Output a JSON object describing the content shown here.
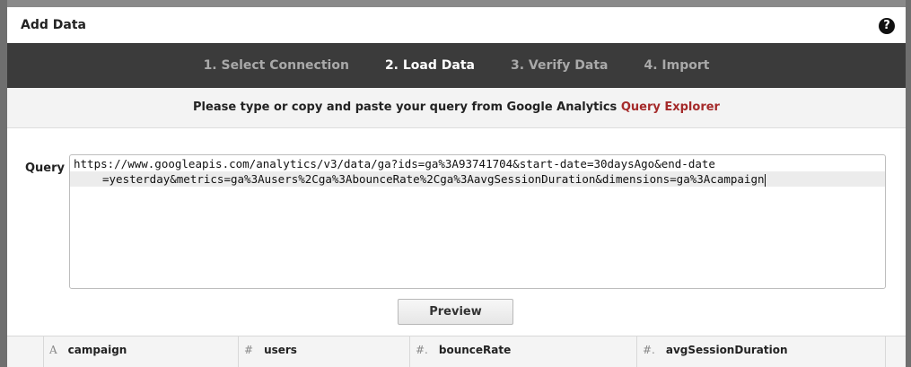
{
  "dialog": {
    "title": "Add Data",
    "help_icon": "?"
  },
  "steps": [
    {
      "label": "1. Select Connection",
      "active": false
    },
    {
      "label": "2. Load Data",
      "active": true
    },
    {
      "label": "3. Verify Data",
      "active": false
    },
    {
      "label": "4. Import",
      "active": false
    }
  ],
  "instructions": {
    "text": "Please type or copy and paste your query from Google Analytics ",
    "link": "Query Explorer"
  },
  "query": {
    "label": "Query",
    "line1": "https://www.googleapis.com/analytics/v3/data/ga?ids=ga%3A93741704&start-date=30daysAgo&end-date",
    "line2": "=yesterday&metrics=ga%3Ausers%2Cga%3AbounceRate%2Cga%3AavgSessionDuration&dimensions=ga%3Acampaign"
  },
  "preview_button": "Preview",
  "columns": [
    {
      "icon": "A",
      "name": "campaign"
    },
    {
      "icon": "#",
      "name": "users"
    },
    {
      "icon": "#.",
      "name": "bounceRate"
    },
    {
      "icon": "#.",
      "name": "avgSessionDuration"
    }
  ],
  "colors": {
    "stepbar": "#3b3b3b",
    "link": "#a52a2a",
    "active_step": "#ffffff",
    "inactive_step": "#a9a9a9"
  }
}
